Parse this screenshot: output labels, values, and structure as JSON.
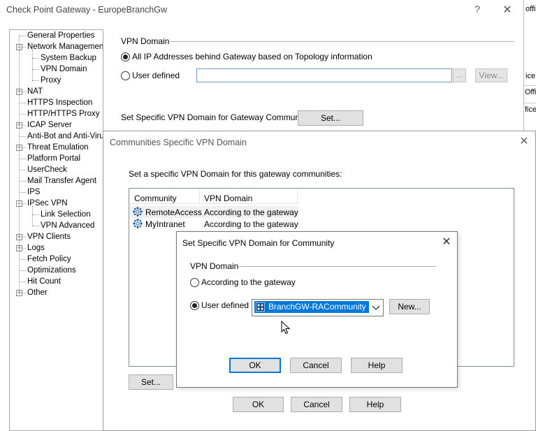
{
  "main_window": {
    "title": "Check Point Gateway - EuropeBranchGw",
    "help_button": "?",
    "close_button": "✕"
  },
  "background_window": {
    "fragments": [
      "offi",
      "ice",
      "Offi",
      "fice"
    ]
  },
  "tree": {
    "items": [
      {
        "label": "General Properties",
        "level": 0,
        "expander": ""
      },
      {
        "label": "Network Management",
        "level": 0,
        "expander": "−"
      },
      {
        "label": "System Backup",
        "level": 1,
        "expander": ""
      },
      {
        "label": "VPN Domain",
        "level": 1,
        "expander": ""
      },
      {
        "label": "Proxy",
        "level": 1,
        "expander": ""
      },
      {
        "label": "NAT",
        "level": 0,
        "expander": "+"
      },
      {
        "label": "HTTPS Inspection",
        "level": 0,
        "expander": ""
      },
      {
        "label": "HTTP/HTTPS Proxy",
        "level": 0,
        "expander": ""
      },
      {
        "label": "ICAP Server",
        "level": 0,
        "expander": "+"
      },
      {
        "label": "Anti-Bot and Anti-Virus",
        "level": 0,
        "expander": ""
      },
      {
        "label": "Threat Emulation",
        "level": 0,
        "expander": "+"
      },
      {
        "label": "Platform Portal",
        "level": 0,
        "expander": ""
      },
      {
        "label": "UserCheck",
        "level": 0,
        "expander": ""
      },
      {
        "label": "Mail Transfer Agent",
        "level": 0,
        "expander": ""
      },
      {
        "label": "IPS",
        "level": 0,
        "expander": ""
      },
      {
        "label": "IPSec VPN",
        "level": 0,
        "expander": "−"
      },
      {
        "label": "Link Selection",
        "level": 1,
        "expander": ""
      },
      {
        "label": "VPN Advanced",
        "level": 1,
        "expander": ""
      },
      {
        "label": "VPN Clients",
        "level": 0,
        "expander": "+"
      },
      {
        "label": "Logs",
        "level": 0,
        "expander": "+"
      },
      {
        "label": "Fetch Policy",
        "level": 0,
        "expander": ""
      },
      {
        "label": "Optimizations",
        "level": 0,
        "expander": ""
      },
      {
        "label": "Hit Count",
        "level": 0,
        "expander": ""
      },
      {
        "label": "Other",
        "level": 0,
        "expander": "+"
      }
    ]
  },
  "vpn_domain_page": {
    "group_label": "VPN Domain",
    "option_topology": "All IP Addresses behind Gateway based on Topology information",
    "option_user_defined": "User defined",
    "selected": "topology",
    "user_defined_value": "",
    "browse_button": "...",
    "view_button": "View...",
    "communities_label": "Set Specific VPN Domain for Gateway Communities:",
    "set_button": "Set..."
  },
  "communities_dialog": {
    "title": "Communities Specific VPN Domain",
    "description": "Set a specific VPN Domain for this gateway communities:",
    "columns": [
      "Community",
      "VPN Domain"
    ],
    "rows": [
      {
        "community": "RemoteAccess",
        "vpn_domain": "According to the gateway",
        "icon": "community-star-icon"
      },
      {
        "community": "MyIntranet",
        "vpn_domain": "According to the gateway",
        "icon": "community-star-icon"
      }
    ],
    "set_button": "Set...",
    "ok_button": "OK",
    "cancel_button": "Cancel",
    "help_button": "Help"
  },
  "community_dialog": {
    "title": "Set Specific VPN Domain for Community",
    "group_label": "VPN Domain",
    "option_gateway": "According to the gateway",
    "option_user_defined": "User defined",
    "selected": "user_defined",
    "combo_value": "BranchGW-RACommunity",
    "combo_icon": "network-group-icon",
    "new_button": "New...",
    "ok_button": "OK",
    "cancel_button": "Cancel",
    "help_button": "Help"
  },
  "colors": {
    "selection": "#0078d7",
    "button_face": "#e1e1e1",
    "community_icon": "#1f5f9e"
  }
}
